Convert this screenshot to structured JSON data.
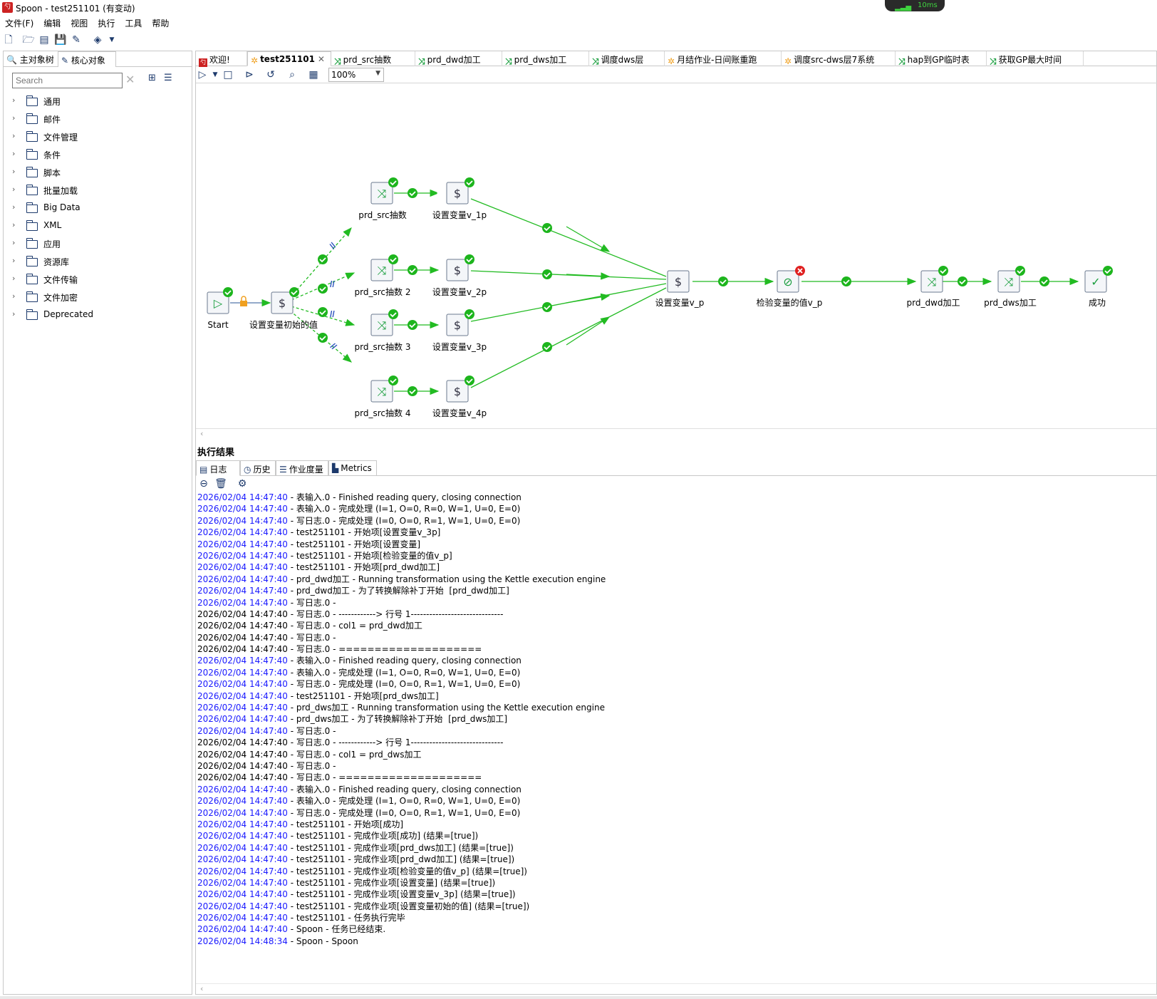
{
  "window": {
    "title": "Spoon - test251101 (有变动)",
    "app_icon": "spoon-logo-icon",
    "network_badge": "10ms"
  },
  "menu": [
    "文件(F)",
    "编辑",
    "视图",
    "执行",
    "工具",
    "帮助"
  ],
  "left_panel": {
    "tabs": [
      "主对象树",
      "核心对象"
    ],
    "search_placeholder": "Search",
    "tree_items": [
      "通用",
      "邮件",
      "文件管理",
      "条件",
      "脚本",
      "批量加载",
      "Big Data",
      "XML",
      "应用",
      "资源库",
      "文件传输",
      "文件加密",
      "Deprecated"
    ]
  },
  "doc_tabs": [
    {
      "label": "欢迎!",
      "icon": "welcome-icon"
    },
    {
      "label": "test251101",
      "icon": "job-icon",
      "active": true
    },
    {
      "label": "prd_src抽数",
      "icon": "transformation-icon"
    },
    {
      "label": "prd_dwd加工",
      "icon": "transformation-icon"
    },
    {
      "label": "prd_dws加工",
      "icon": "transformation-icon"
    },
    {
      "label": "调度dws层",
      "icon": "transformation-icon"
    },
    {
      "label": "月结作业-日间账重跑",
      "icon": "job-icon"
    },
    {
      "label": "调度src-dws层7系统",
      "icon": "job-icon"
    },
    {
      "label": "hap到GP临时表",
      "icon": "transformation-icon"
    },
    {
      "label": "获取GP最大时间",
      "icon": "transformation-icon"
    }
  ],
  "editor_toolbar": {
    "zoom": "100%"
  },
  "canvas": {
    "nodes": {
      "start": "Start",
      "init": "设置变量初始的值",
      "src1": "prd_src抽数",
      "src2": "prd_src抽数 2",
      "src3": "prd_src抽数 3",
      "src4": "prd_src抽数 4",
      "v1": "设置变量v_1p",
      "v2": "设置变量v_2p",
      "v3": "设置变量v_3p",
      "v4": "设置变量v_4p",
      "vp": "设置变量v_p",
      "check": "检验变量的值v_p",
      "dwd": "prd_dwd加工",
      "dws": "prd_dws加工",
      "success": "成功"
    }
  },
  "results": {
    "title": "执行结果",
    "tabs": [
      "日志",
      "历史",
      "作业度量",
      "Metrics"
    ],
    "log": [
      {
        "ts": "2026/02/04 14:47:40",
        "msg": " - 表输入.0 - Finished reading query, closing connection",
        "blue": true
      },
      {
        "ts": "2026/02/04 14:47:40",
        "msg": " - 表输入.0 - 完成处理 (I=1, O=0, R=0, W=1, U=0, E=0)",
        "blue": true
      },
      {
        "ts": "2026/02/04 14:47:40",
        "msg": " - 写日志.0 - 完成处理 (I=0, O=0, R=1, W=1, U=0, E=0)",
        "blue": true
      },
      {
        "ts": "2026/02/04 14:47:40",
        "msg": " - test251101 - 开始项[设置变量v_3p]",
        "blue": true
      },
      {
        "ts": "2026/02/04 14:47:40",
        "msg": " - test251101 - 开始项[设置变量]",
        "blue": true
      },
      {
        "ts": "2026/02/04 14:47:40",
        "msg": " - test251101 - 开始项[检验变量的值v_p]",
        "blue": true
      },
      {
        "ts": "2026/02/04 14:47:40",
        "msg": " - test251101 - 开始项[prd_dwd加工]",
        "blue": true
      },
      {
        "ts": "2026/02/04 14:47:40",
        "msg": " - prd_dwd加工 - Running transformation using the Kettle execution engine",
        "blue": true
      },
      {
        "ts": "2026/02/04 14:47:40",
        "msg": " - prd_dwd加工 - 为了转换解除补丁开始  [prd_dwd加工]",
        "blue": true
      },
      {
        "ts": "2026/02/04 14:47:40",
        "msg": " - 写日志.0 - ",
        "blue": true
      },
      {
        "ts": "2026/02/04 14:47:40",
        "msg": " - 写日志.0 - ------------> 行号 1------------------------------",
        "blue": false
      },
      {
        "ts": "2026/02/04 14:47:40",
        "msg": " - 写日志.0 - col1 = prd_dwd加工",
        "blue": false
      },
      {
        "ts": "2026/02/04 14:47:40",
        "msg": " - 写日志.0 - ",
        "blue": false
      },
      {
        "ts": "2026/02/04 14:47:40",
        "msg": " - 写日志.0 - ====================",
        "blue": false
      },
      {
        "ts": "2026/02/04 14:47:40",
        "msg": " - 表输入.0 - Finished reading query, closing connection",
        "blue": true
      },
      {
        "ts": "2026/02/04 14:47:40",
        "msg": " - 表输入.0 - 完成处理 (I=1, O=0, R=0, W=1, U=0, E=0)",
        "blue": true
      },
      {
        "ts": "2026/02/04 14:47:40",
        "msg": " - 写日志.0 - 完成处理 (I=0, O=0, R=1, W=1, U=0, E=0)",
        "blue": true
      },
      {
        "ts": "2026/02/04 14:47:40",
        "msg": " - test251101 - 开始项[prd_dws加工]",
        "blue": true
      },
      {
        "ts": "2026/02/04 14:47:40",
        "msg": " - prd_dws加工 - Running transformation using the Kettle execution engine",
        "blue": true
      },
      {
        "ts": "2026/02/04 14:47:40",
        "msg": " - prd_dws加工 - 为了转换解除补丁开始  [prd_dws加工]",
        "blue": true
      },
      {
        "ts": "2026/02/04 14:47:40",
        "msg": " - 写日志.0 - ",
        "blue": true
      },
      {
        "ts": "2026/02/04 14:47:40",
        "msg": " - 写日志.0 - ------------> 行号 1------------------------------",
        "blue": false
      },
      {
        "ts": "2026/02/04 14:47:40",
        "msg": " - 写日志.0 - col1 = prd_dws加工",
        "blue": false
      },
      {
        "ts": "2026/02/04 14:47:40",
        "msg": " - 写日志.0 - ",
        "blue": false
      },
      {
        "ts": "2026/02/04 14:47:40",
        "msg": " - 写日志.0 - ====================",
        "blue": false
      },
      {
        "ts": "2026/02/04 14:47:40",
        "msg": " - 表输入.0 - Finished reading query, closing connection",
        "blue": true
      },
      {
        "ts": "2026/02/04 14:47:40",
        "msg": " - 表输入.0 - 完成处理 (I=1, O=0, R=0, W=1, U=0, E=0)",
        "blue": true
      },
      {
        "ts": "2026/02/04 14:47:40",
        "msg": " - 写日志.0 - 完成处理 (I=0, O=0, R=1, W=1, U=0, E=0)",
        "blue": true
      },
      {
        "ts": "2026/02/04 14:47:40",
        "msg": " - test251101 - 开始项[成功]",
        "blue": true
      },
      {
        "ts": "2026/02/04 14:47:40",
        "msg": " - test251101 - 完成作业项[成功] (结果=[true])",
        "blue": true
      },
      {
        "ts": "2026/02/04 14:47:40",
        "msg": " - test251101 - 完成作业项[prd_dws加工] (结果=[true])",
        "blue": true
      },
      {
        "ts": "2026/02/04 14:47:40",
        "msg": " - test251101 - 完成作业项[prd_dwd加工] (结果=[true])",
        "blue": true
      },
      {
        "ts": "2026/02/04 14:47:40",
        "msg": " - test251101 - 完成作业项[检验变量的值v_p] (结果=[true])",
        "blue": true
      },
      {
        "ts": "2026/02/04 14:47:40",
        "msg": " - test251101 - 完成作业项[设置变量] (结果=[true])",
        "blue": true
      },
      {
        "ts": "2026/02/04 14:47:40",
        "msg": " - test251101 - 完成作业项[设置变量v_3p] (结果=[true])",
        "blue": true
      },
      {
        "ts": "2026/02/04 14:47:40",
        "msg": " - test251101 - 完成作业项[设置变量初始的值] (结果=[true])",
        "blue": true
      },
      {
        "ts": "2026/02/04 14:47:40",
        "msg": " - test251101 - 任务执行完毕",
        "blue": true
      },
      {
        "ts": "2026/02/04 14:47:40",
        "msg": " - Spoon - 任务已经结束.",
        "blue": true
      },
      {
        "ts": "2026/02/04 14:48:34",
        "msg": " - Spoon - Spoon",
        "blue": true
      }
    ]
  },
  "colors": {
    "hop": "#22bb22",
    "ok": "#1db51d",
    "error": "#e02020",
    "log_timestamp": "#1a1aff"
  }
}
